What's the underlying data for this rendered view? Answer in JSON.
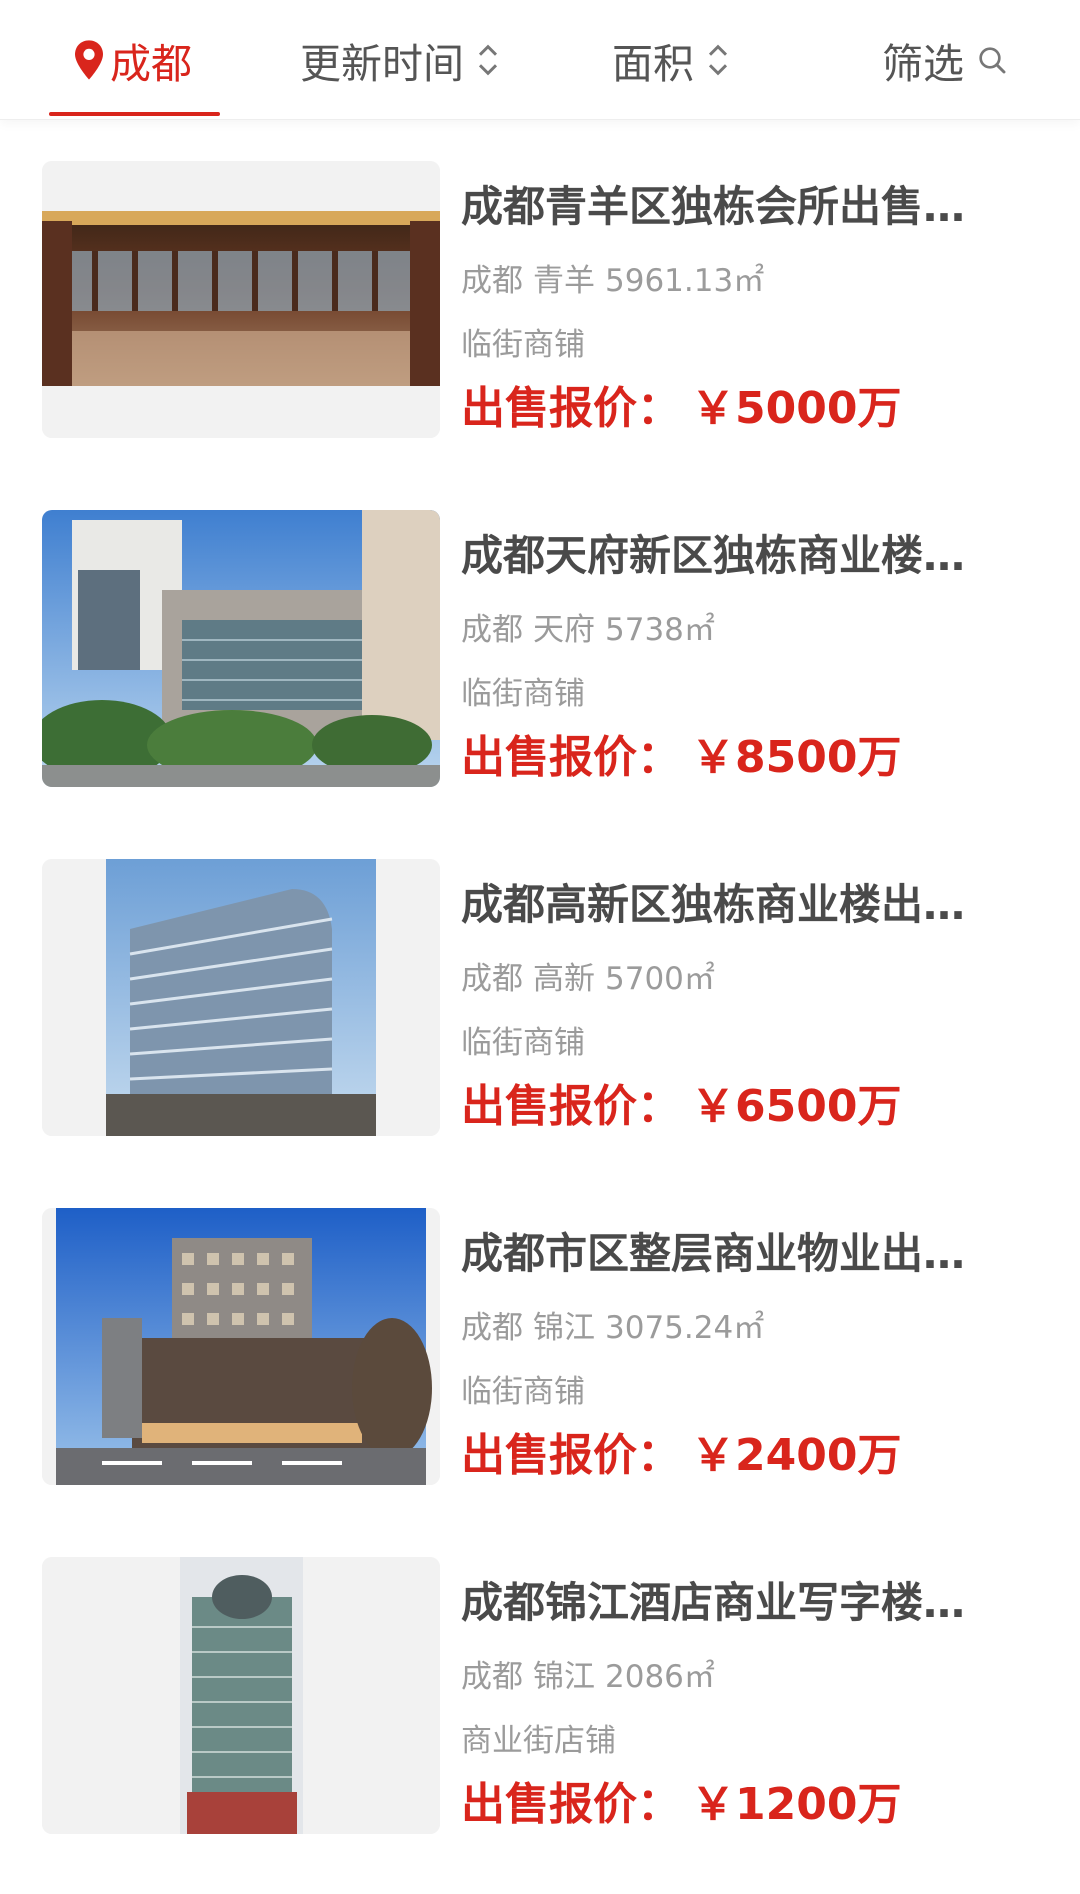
{
  "previous_item_type": "临街商铺",
  "filter_bar": {
    "city_label": "成都",
    "update_time_label": "更新时间",
    "area_label": "面积",
    "screen_label": "筛选"
  },
  "listings": [
    {
      "title": "成都青羊区独栋会所出售…",
      "city": "成都",
      "district": "青羊",
      "area": "5961.13㎡",
      "type": "临街商铺",
      "price_label": "出售报价：",
      "price_value": "￥5000万",
      "image": "hall-interior"
    },
    {
      "title": "成都天府新区独栋商业楼…",
      "city": "成都",
      "district": "天府",
      "area": "5738㎡",
      "type": "临街商铺",
      "price_label": "出售报价：",
      "price_value": "￥8500万",
      "image": "building-street"
    },
    {
      "title": "成都高新区独栋商业楼出…",
      "city": "成都",
      "district": "高新",
      "area": "5700㎡",
      "type": "临街商铺",
      "price_label": "出售报价：",
      "price_value": "￥6500万",
      "image": "glass-building"
    },
    {
      "title": "成都市区整层商业物业出…",
      "city": "成都",
      "district": "锦江",
      "area": "3075.24㎡",
      "type": "临街商铺",
      "price_label": "出售报价：",
      "price_value": "￥2400万",
      "image": "corner-building"
    },
    {
      "title": "成都锦江酒店商业写字楼…",
      "city": "成都",
      "district": "锦江",
      "area": "2086㎡",
      "type": "商业街店铺",
      "price_label": "出售报价：",
      "price_value": "￥1200万",
      "image": "tower"
    }
  ],
  "colors": {
    "accent": "#d9251c",
    "title": "#4a4a4a",
    "meta": "#9b9b9b",
    "thumb_bg": "#f2f2f2"
  }
}
